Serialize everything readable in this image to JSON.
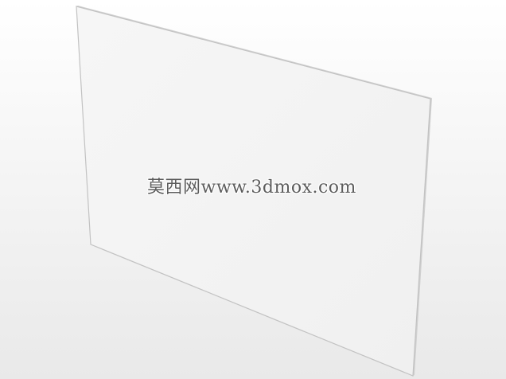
{
  "watermark": {
    "text": "莫西网www.3dmox.com"
  },
  "colors": {
    "background_top": "#ffffff",
    "background_bottom": "#e9e9e9",
    "panel_fill": "#f4f4f4",
    "panel_edge": "#c4c4c4"
  }
}
